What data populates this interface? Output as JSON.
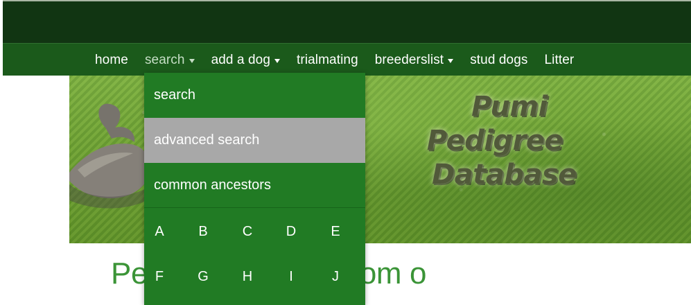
{
  "colors": {
    "top_bar": "#113512",
    "nav_bar": "#1b5a1b",
    "dropdown": "#217b24",
    "dropdown_hover": "#a8a8a8",
    "headline": "#3b9437"
  },
  "nav": {
    "items": [
      {
        "label": "home",
        "has_menu": false
      },
      {
        "label": "search",
        "has_menu": true,
        "active": true
      },
      {
        "label": "add a dog",
        "has_menu": true
      },
      {
        "label": "trialmating",
        "has_menu": false
      },
      {
        "label": "breederslist",
        "has_menu": true
      },
      {
        "label": "stud dogs",
        "has_menu": false
      },
      {
        "label": "Litter",
        "has_menu": false
      }
    ]
  },
  "banner": {
    "title_lines": [
      "Pumi",
      "Pedigree",
      "Database"
    ]
  },
  "search_menu": {
    "items": [
      {
        "label": "search"
      },
      {
        "label": "advanced search"
      },
      {
        "label": "common ancestors"
      }
    ],
    "letters": [
      "A",
      "B",
      "C",
      "D",
      "E",
      "F",
      "G",
      "H",
      "I",
      "J"
    ]
  },
  "headline": {
    "visible_text": "Pe                  health results from o"
  }
}
